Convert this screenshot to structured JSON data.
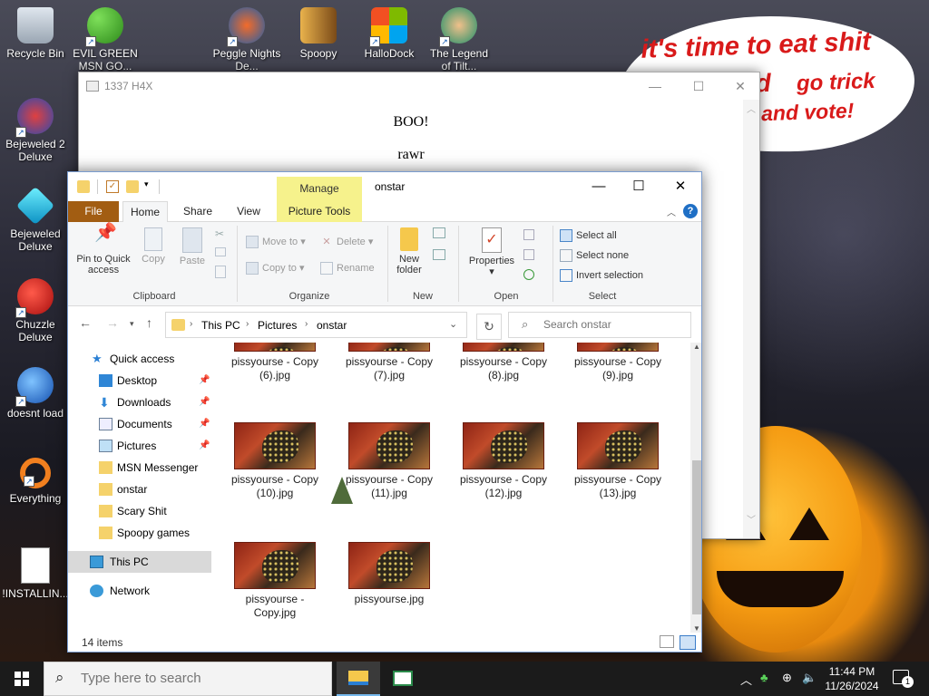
{
  "wallpaper": {
    "bubble_lines": [
      "it's time to eat shit",
      "and",
      "go trick",
      "and vote!"
    ]
  },
  "desktop_icons": [
    {
      "label": "Recycle Bin",
      "icon": "recycle-bin-icon"
    },
    {
      "label": "EVIL GREEN MSN GO...",
      "icon": "msn-buddy-icon"
    },
    {
      "label": "Peggle Nights De...",
      "icon": "peggle-icon"
    },
    {
      "label": "Spoopy",
      "icon": "spoopy-folder-icon"
    },
    {
      "label": "HalloDock",
      "icon": "windows-logo-icon"
    },
    {
      "label": "The Legend of Tilt...",
      "icon": "legend-game-icon"
    },
    {
      "label": "Bejeweled 2 Deluxe",
      "icon": "bejeweled2-icon"
    },
    {
      "label": "Bejeweled Deluxe",
      "icon": "bejeweled-diamond-icon"
    },
    {
      "label": "Chuzzle Deluxe",
      "icon": "chuzzle-icon"
    },
    {
      "label": "doesnt load",
      "icon": "thunderbird-icon"
    },
    {
      "label": "Everything",
      "icon": "everything-search-icon"
    },
    {
      "label": "!INSTALLIN...",
      "icon": "text-file-icon"
    }
  ],
  "back_window": {
    "title": "1337 H4X",
    "line1": "BOO!",
    "line2": "rawr"
  },
  "explorer": {
    "title": "onstar",
    "contextual_tab_group": "Manage",
    "tabs": [
      "File",
      "Home",
      "Share",
      "View",
      "Picture Tools"
    ],
    "ribbon": {
      "clipboard": {
        "pin": "Pin to Quick access",
        "copy": "Copy",
        "paste": "Paste",
        "label": "Clipboard"
      },
      "organize": {
        "move_to": "Move to",
        "copy_to": "Copy to",
        "delete": "Delete",
        "rename": "Rename",
        "label": "Organize"
      },
      "new": {
        "new_folder": "New folder",
        "label": "New"
      },
      "open": {
        "properties": "Properties",
        "label": "Open"
      },
      "select": {
        "select_all": "Select all",
        "select_none": "Select none",
        "invert": "Invert selection",
        "label": "Select"
      }
    },
    "breadcrumb": [
      "This PC",
      "Pictures",
      "onstar"
    ],
    "search_placeholder": "Search onstar",
    "nav": {
      "quick_access": "Quick access",
      "items": [
        {
          "label": "Desktop",
          "pinned": true,
          "icon": "desktop-icon"
        },
        {
          "label": "Downloads",
          "pinned": true,
          "icon": "download-icon"
        },
        {
          "label": "Documents",
          "pinned": true,
          "icon": "documents-icon"
        },
        {
          "label": "Pictures",
          "pinned": true,
          "icon": "pictures-icon"
        },
        {
          "label": "MSN Messenger",
          "pinned": false,
          "icon": "folder-icon"
        },
        {
          "label": "onstar",
          "pinned": false,
          "icon": "folder-icon"
        },
        {
          "label": "Scary Shit",
          "pinned": false,
          "icon": "folder-icon"
        },
        {
          "label": "Spoopy games",
          "pinned": false,
          "icon": "folder-icon"
        }
      ],
      "this_pc": "This PC",
      "network": "Network"
    },
    "files": [
      "pissyourse - Copy (6).jpg",
      "pissyourse - Copy (7).jpg",
      "pissyourse - Copy (8).jpg",
      "pissyourse - Copy (9).jpg",
      "pissyourse - Copy (10).jpg",
      "pissyourse - Copy (11).jpg",
      "pissyourse - Copy (12).jpg",
      "pissyourse - Copy (13).jpg",
      "pissyourse - Copy.jpg",
      "pissyourse.jpg"
    ],
    "status": "14 items"
  },
  "taskbar": {
    "search_placeholder": "Type here to search",
    "time": "11:44 PM",
    "date": "11/26/2024",
    "notification_count": "1"
  },
  "colors": {
    "file_tab": "#a25d12",
    "contextual_tab": "#f6f28c",
    "bubble_text": "#d91a1a",
    "taskbar": "#1b1b1b"
  }
}
